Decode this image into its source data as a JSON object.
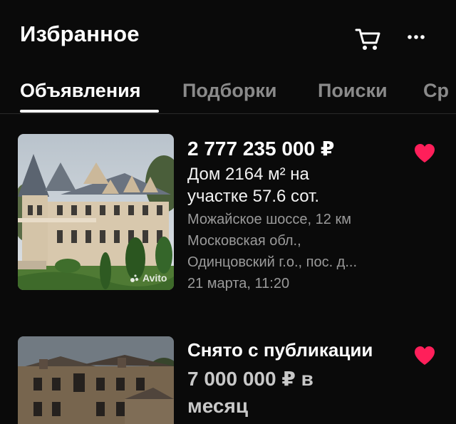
{
  "header": {
    "title": "Избранное",
    "cart_icon": "cart-icon",
    "more_icon": "more-icon"
  },
  "tabs": [
    {
      "label": "Объявления",
      "active": true
    },
    {
      "label": "Подборки",
      "active": false
    },
    {
      "label": "Поиски",
      "active": false
    },
    {
      "label": "Ср",
      "active": false
    }
  ],
  "listings": [
    {
      "price": "2 777 235 000 ₽",
      "description": "Дом 2164 м² на участке 57.6 сот.",
      "address_1": "Можайское шоссе, 12 км",
      "address_2": "Московская обл.,",
      "address_3": "Одинцовский г.о., пос. д...",
      "date": "21 марта, 11:20",
      "watermark": "Avito",
      "favorited": true
    },
    {
      "status": "Снято с публикации",
      "price": "7 000 000 ₽ в месяц",
      "favorited": true
    }
  ],
  "colors": {
    "background": "#0a0a0a",
    "heart": "#ff1f5a",
    "muted_text": "#9a9a9a",
    "inactive_tab": "#8a8a8a"
  }
}
